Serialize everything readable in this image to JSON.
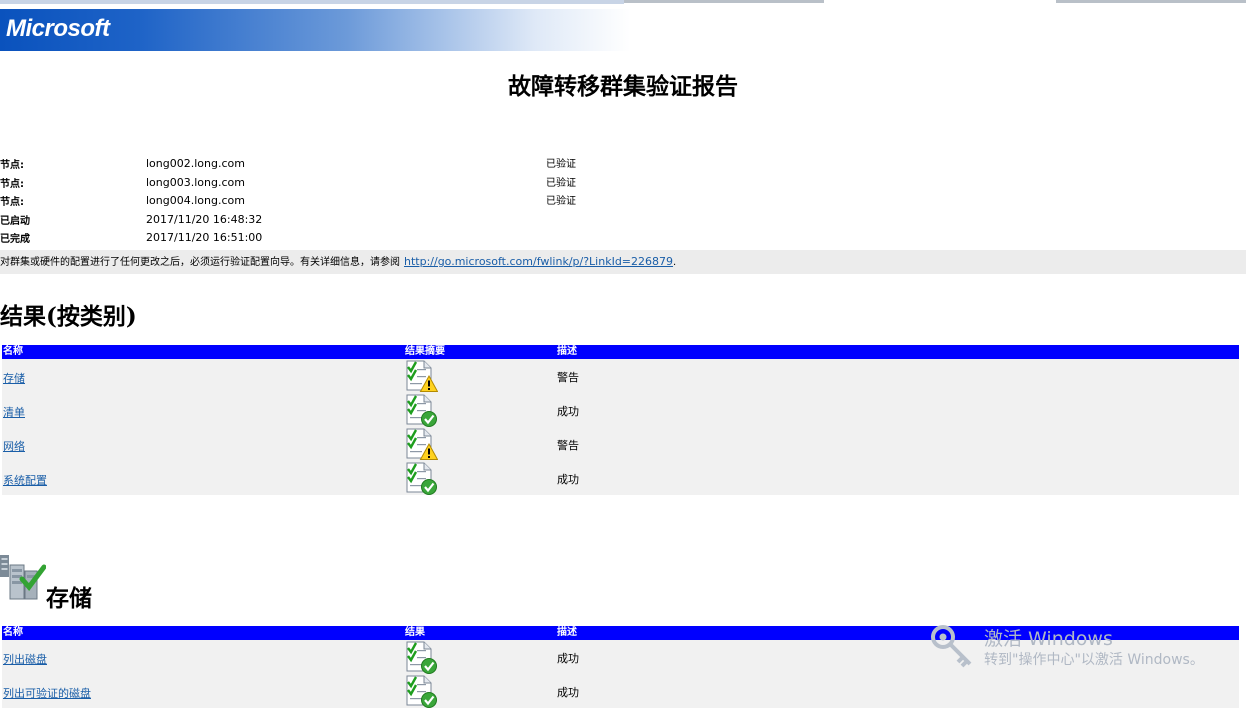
{
  "banner": {
    "logo": "Microsoft"
  },
  "report": {
    "title": "故障转移群集验证报告"
  },
  "info": [
    {
      "label": "节点:",
      "value": "long002.long.com",
      "status": "已验证"
    },
    {
      "label": "节点:",
      "value": "long003.long.com",
      "status": "已验证"
    },
    {
      "label": "节点:",
      "value": "long004.long.com",
      "status": "已验证"
    },
    {
      "label": "已启动",
      "value": "2017/11/20 16:48:32",
      "status": ""
    },
    {
      "label": "已完成",
      "value": "2017/11/20 16:51:00",
      "status": ""
    }
  ],
  "notice": {
    "text": "对群集或硬件的配置进行了任何更改之后，必须运行验证配置向导。有关详细信息，请参阅",
    "link": "http://go.microsoft.com/fwlink/p/?LinkId=226879",
    "suffix": "."
  },
  "results_section": {
    "heading": "结果(按类别)",
    "columns": [
      "名称",
      "结果摘要",
      "描述"
    ],
    "rows": [
      {
        "name": "存储",
        "icon": "warning",
        "desc": "警告"
      },
      {
        "name": "清单",
        "icon": "success",
        "desc": "成功"
      },
      {
        "name": "网络",
        "icon": "warning",
        "desc": "警告"
      },
      {
        "name": "系统配置",
        "icon": "success",
        "desc": "成功"
      }
    ]
  },
  "storage_section": {
    "heading": "存储",
    "columns": [
      "名称",
      "结果",
      "描述"
    ],
    "rows": [
      {
        "name": "列出磁盘",
        "icon": "success",
        "desc": "成功"
      },
      {
        "name": "列出可验证的磁盘",
        "icon": "success",
        "desc": "成功"
      }
    ]
  },
  "watermark": {
    "line1": "激活 Windows",
    "line2": "转到\"操作中心\"以激活 Windows。"
  },
  "colors": {
    "table_header": "#0000ff",
    "link": "#1a5ea8",
    "notice_bg": "#ececec",
    "row_bg": "#f1f1f1"
  }
}
